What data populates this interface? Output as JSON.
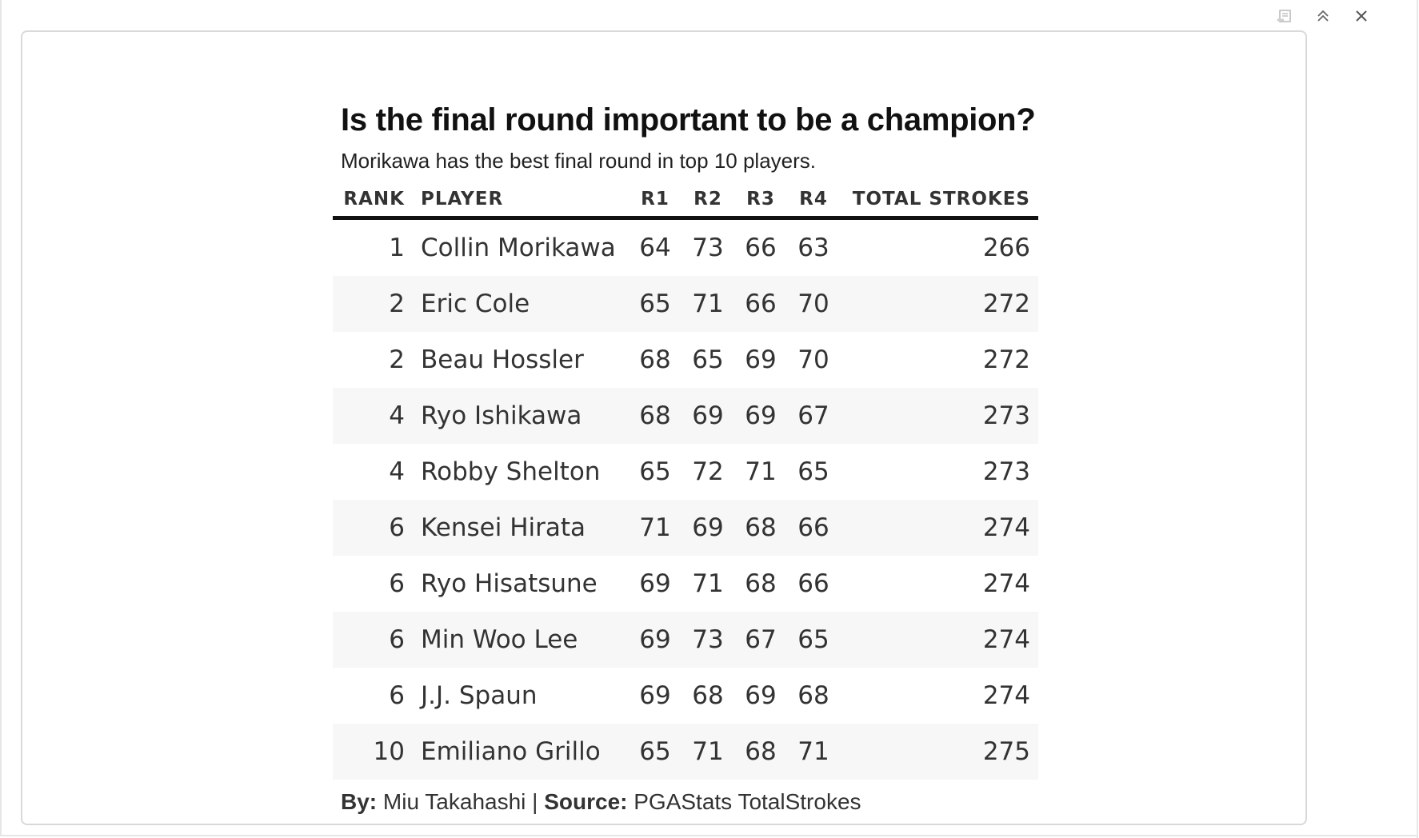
{
  "toolbar": {
    "icons": [
      "export-icon",
      "collapse-icon",
      "close-icon"
    ]
  },
  "table": {
    "title": "Is the final round important to be a champion?",
    "subtitle": "Morikawa has the best final round in top 10 players.",
    "columns": {
      "rank": "RANK",
      "player": "PLAYER",
      "r1": "R1",
      "r2": "R2",
      "r3": "R3",
      "r4": "R4",
      "total": "TOTAL STROKES"
    },
    "rows": [
      {
        "rank": "1",
        "player": "Collin Morikawa",
        "r1": "64",
        "r2": "73",
        "r3": "66",
        "r4": "63",
        "total": "266"
      },
      {
        "rank": "2",
        "player": "Eric Cole",
        "r1": "65",
        "r2": "71",
        "r3": "66",
        "r4": "70",
        "total": "272"
      },
      {
        "rank": "2",
        "player": "Beau Hossler",
        "r1": "68",
        "r2": "65",
        "r3": "69",
        "r4": "70",
        "total": "272"
      },
      {
        "rank": "4",
        "player": "Ryo Ishikawa",
        "r1": "68",
        "r2": "69",
        "r3": "69",
        "r4": "67",
        "total": "273"
      },
      {
        "rank": "4",
        "player": "Robby Shelton",
        "r1": "65",
        "r2": "72",
        "r3": "71",
        "r4": "65",
        "total": "273"
      },
      {
        "rank": "6",
        "player": "Kensei Hirata",
        "r1": "71",
        "r2": "69",
        "r3": "68",
        "r4": "66",
        "total": "274"
      },
      {
        "rank": "6",
        "player": "Ryo Hisatsune",
        "r1": "69",
        "r2": "71",
        "r3": "68",
        "r4": "66",
        "total": "274"
      },
      {
        "rank": "6",
        "player": "Min Woo Lee",
        "r1": "69",
        "r2": "73",
        "r3": "67",
        "r4": "65",
        "total": "274"
      },
      {
        "rank": "6",
        "player": "J.J. Spaun",
        "r1": "69",
        "r2": "68",
        "r3": "69",
        "r4": "68",
        "total": "274"
      },
      {
        "rank": "10",
        "player": "Emiliano Grillo",
        "r1": "65",
        "r2": "71",
        "r3": "68",
        "r4": "71",
        "total": "275"
      }
    ],
    "footer": {
      "by_label": "By:",
      "author": " Miu Takahashi | ",
      "source_label": "Source:",
      "source": " PGAStats TotalStrokes"
    }
  }
}
